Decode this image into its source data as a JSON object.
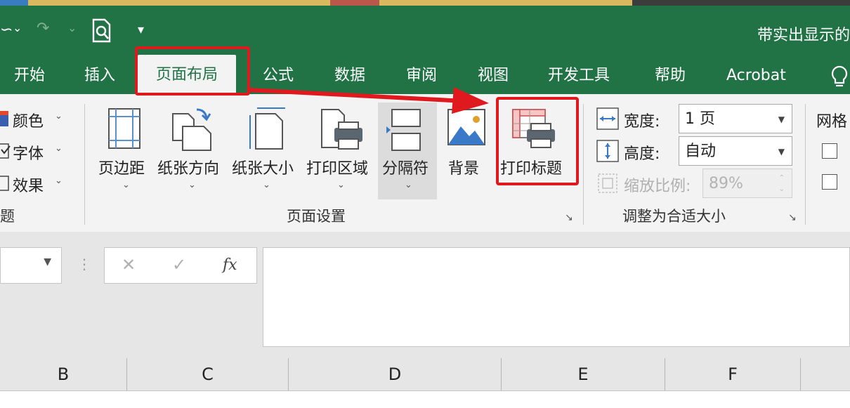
{
  "window": {
    "title": "带实出显示的"
  },
  "qat": {
    "save_glyph": "∽",
    "dropdown": "⌄",
    "redo_glyph": "↷",
    "customize": "▾"
  },
  "tabs": [
    {
      "label": "开始"
    },
    {
      "label": "插入"
    },
    {
      "label": "页面布局",
      "active": true
    },
    {
      "label": "公式"
    },
    {
      "label": "数据"
    },
    {
      "label": "审阅"
    },
    {
      "label": "视图"
    },
    {
      "label": "开发工具"
    },
    {
      "label": "帮助"
    },
    {
      "label": "Acrobat"
    }
  ],
  "theme_group": {
    "label": "题",
    "items": [
      {
        "label": "颜色"
      },
      {
        "label": "字体"
      },
      {
        "label": "效果"
      }
    ]
  },
  "page_setup_group": {
    "label": "页面设置",
    "buttons": [
      {
        "label": "页边距"
      },
      {
        "label": "纸张方向"
      },
      {
        "label": "纸张大小"
      },
      {
        "label": "打印区域"
      },
      {
        "label": "分隔符"
      },
      {
        "label": "背景"
      },
      {
        "label": "打印标题"
      }
    ],
    "caret": "⌄"
  },
  "scale_group": {
    "label": "调整为合适大小",
    "width_label": "宽度:",
    "width_value": "1 页",
    "height_label": "高度:",
    "height_value": "自动",
    "scale_label": "缩放比例:",
    "scale_value": "89%"
  },
  "sheet_options_group": {
    "label": "网格"
  },
  "launcher_glyph": "↘",
  "formula_bar": {
    "cancel": "✕",
    "enter": "✓",
    "fx": "fx",
    "dots": "⋮"
  },
  "columns": [
    {
      "label": "B"
    },
    {
      "label": "C"
    },
    {
      "label": "D"
    },
    {
      "label": "E"
    },
    {
      "label": "F"
    }
  ],
  "colors": {
    "excel_green": "#217346",
    "ribbon_bg": "#f3f3f3",
    "highlight_red": "#e0191f"
  }
}
